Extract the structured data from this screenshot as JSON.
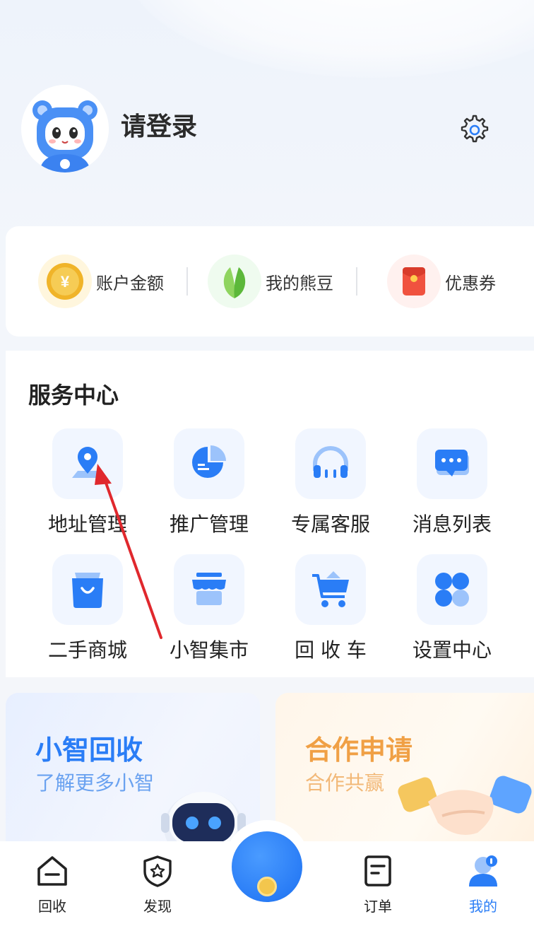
{
  "header": {
    "login_title": "请登录"
  },
  "wallet": {
    "items": [
      {
        "label": "账户金额",
        "icon": "coin-icon"
      },
      {
        "label": "我的熊豆",
        "icon": "leaf-icon"
      },
      {
        "label": "优惠券",
        "icon": "red-envelope-icon"
      }
    ]
  },
  "service_center": {
    "title": "服务中心",
    "items": [
      {
        "label": "地址管理",
        "icon": "location-pin-icon"
      },
      {
        "label": "推广管理",
        "icon": "pie-chart-icon"
      },
      {
        "label": "专属客服",
        "icon": "headset-icon"
      },
      {
        "label": "消息列表",
        "icon": "chat-bubble-icon"
      },
      {
        "label": "二手商城",
        "icon": "shopping-bag-icon"
      },
      {
        "label": "小智集市",
        "icon": "storefront-icon"
      },
      {
        "label": "回 收 车",
        "icon": "cart-icon"
      },
      {
        "label": "设置中心",
        "icon": "grid-apps-icon"
      }
    ]
  },
  "promos": {
    "left": {
      "title": "小智回收",
      "subtitle": "了解更多小智"
    },
    "right": {
      "title": "合作申请",
      "subtitle": "合作共赢"
    }
  },
  "bottom_nav": {
    "items": [
      {
        "label": "回收",
        "icon": "home-icon"
      },
      {
        "label": "发现",
        "icon": "shield-star-icon"
      },
      {
        "label": "订单",
        "icon": "document-icon"
      },
      {
        "label": "我的",
        "icon": "user-icon"
      }
    ],
    "active": "我的"
  },
  "colors": {
    "accent": "#2a7df6",
    "promo_left_title": "#2a7df6",
    "promo_left_sub": "#6aa2f0",
    "promo_right_title": "#f0a045",
    "promo_right_sub": "#f2b877",
    "annotation_arrow": "#e0282d"
  }
}
